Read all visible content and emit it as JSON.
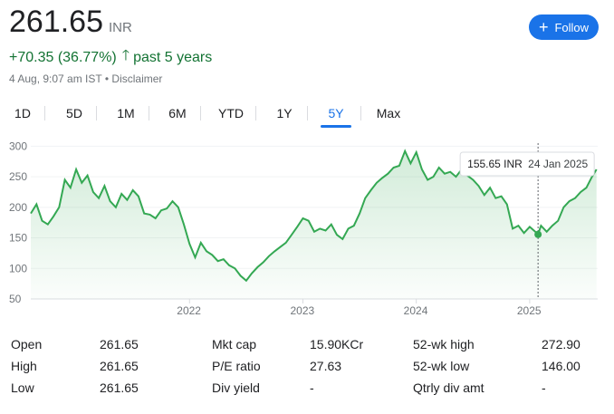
{
  "quote": {
    "price": "261.65",
    "currency": "INR",
    "change": "+70.35 (36.77%)",
    "change_arrow_icon": "arrow-up-icon",
    "period": "past 5 years",
    "timestamp": "4 Aug, 9:07 am IST",
    "separator": "•",
    "disclaimer": "Disclaimer",
    "accent_green": "#137333"
  },
  "follow": {
    "label": "Follow",
    "icon": "plus-icon",
    "color": "#1a73e8"
  },
  "tabs": [
    {
      "label": "1D",
      "active": false
    },
    {
      "label": "5D",
      "active": false
    },
    {
      "label": "1M",
      "active": false
    },
    {
      "label": "6M",
      "active": false
    },
    {
      "label": "YTD",
      "active": false
    },
    {
      "label": "1Y",
      "active": false
    },
    {
      "label": "5Y",
      "active": true
    },
    {
      "label": "Max",
      "active": false
    }
  ],
  "tooltip": {
    "value": "155.65 INR",
    "date": "24 Jan 2025"
  },
  "chart_data": {
    "type": "area",
    "y_ticks": [
      50,
      100,
      150,
      200,
      250,
      300
    ],
    "x_ticks": [
      {
        "label": "2022",
        "t": 2022.0
      },
      {
        "label": "2023",
        "t": 2023.0
      },
      {
        "label": "2024",
        "t": 2024.0
      },
      {
        "label": "2025",
        "t": 2025.0
      }
    ],
    "xlim": [
      2020.6,
      2025.6
    ],
    "ylim": [
      50,
      305
    ],
    "grid": true,
    "line_color": "#34a853",
    "series": [
      {
        "x": [
          2020.6,
          2020.65,
          2020.7,
          2020.75,
          2020.8,
          2020.85,
          2020.9,
          2020.95,
          2021.0,
          2021.05,
          2021.1,
          2021.15,
          2021.2,
          2021.25,
          2021.3,
          2021.35,
          2021.4,
          2021.45,
          2021.5,
          2021.55,
          2021.6,
          2021.65,
          2021.7,
          2021.75,
          2021.8,
          2021.85,
          2021.9,
          2021.95,
          2022.0,
          2022.05,
          2022.1,
          2022.15,
          2022.2,
          2022.25,
          2022.3,
          2022.35,
          2022.4,
          2022.45,
          2022.5,
          2022.55,
          2022.6,
          2022.65,
          2022.7,
          2022.75,
          2022.8,
          2022.85,
          2022.9,
          2022.95,
          2023.0,
          2023.05,
          2023.1,
          2023.15,
          2023.2,
          2023.25,
          2023.3,
          2023.35,
          2023.4,
          2023.45,
          2023.5,
          2023.55,
          2023.6,
          2023.65,
          2023.7,
          2023.75,
          2023.8,
          2023.85,
          2023.9,
          2023.95,
          2024.0,
          2024.05,
          2024.1,
          2024.15,
          2024.2,
          2024.25,
          2024.3,
          2024.35,
          2024.4,
          2024.45,
          2024.5,
          2024.55,
          2024.6,
          2024.65,
          2024.7,
          2024.75,
          2024.8,
          2024.85,
          2024.9,
          2024.95,
          2025.0,
          2025.05,
          2025.074,
          2025.1,
          2025.15,
          2025.2,
          2025.25,
          2025.3,
          2025.35,
          2025.4,
          2025.45,
          2025.5,
          2025.55,
          2025.59
        ],
        "y": [
          190,
          205,
          178,
          172,
          185,
          200,
          245,
          232,
          262,
          240,
          252,
          225,
          215,
          235,
          210,
          200,
          222,
          212,
          228,
          218,
          190,
          188,
          182,
          195,
          198,
          210,
          200,
          172,
          140,
          118,
          142,
          128,
          122,
          112,
          115,
          105,
          100,
          88,
          80,
          92,
          102,
          110,
          120,
          128,
          135,
          142,
          155,
          168,
          182,
          178,
          160,
          165,
          162,
          172,
          155,
          148,
          165,
          170,
          190,
          215,
          228,
          240,
          248,
          255,
          265,
          268,
          292,
          272,
          290,
          262,
          245,
          250,
          265,
          255,
          258,
          250,
          262,
          252,
          245,
          235,
          220,
          232,
          215,
          218,
          205,
          165,
          170,
          158,
          168,
          160,
          155.65,
          170,
          160,
          170,
          178,
          200,
          210,
          215,
          225,
          232,
          250,
          262
        ]
      }
    ],
    "highlight_point": {
      "x": 2025.074,
      "y": 155.65
    }
  },
  "stats": [
    [
      {
        "label": "Open",
        "value": "261.65"
      },
      {
        "label": "Mkt cap",
        "value": "15.90KCr"
      },
      {
        "label": "52-wk high",
        "value": "272.90"
      }
    ],
    [
      {
        "label": "High",
        "value": "261.65"
      },
      {
        "label": "P/E ratio",
        "value": "27.63"
      },
      {
        "label": "52-wk low",
        "value": "146.00"
      }
    ],
    [
      {
        "label": "Low",
        "value": "261.65"
      },
      {
        "label": "Div yield",
        "value": "-"
      },
      {
        "label": "Qtrly div amt",
        "value": "-"
      }
    ]
  ]
}
